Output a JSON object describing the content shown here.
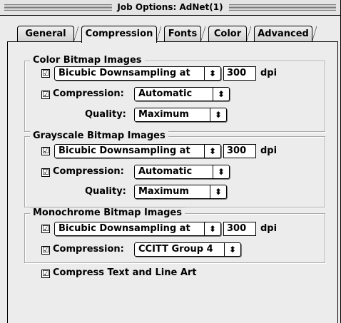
{
  "window": {
    "title": "Job Options: AdNet(1)"
  },
  "tabs": [
    "General",
    "Compression",
    "Fonts",
    "Color",
    "Advanced"
  ],
  "icons": {
    "checkbox_checked": "☑",
    "popup_arrows": "⬍"
  },
  "color_group": {
    "title": "Color Bitmap Images",
    "downsample_method": "Bicubic Downsampling at",
    "resolution": "300",
    "unit": "dpi",
    "compression_label": "Compression:",
    "compression_value": "Automatic",
    "quality_label": "Quality:",
    "quality_value": "Maximum"
  },
  "grayscale_group": {
    "title": "Grayscale Bitmap Images",
    "downsample_method": "Bicubic Downsampling at",
    "resolution": "300",
    "unit": "dpi",
    "compression_label": "Compression:",
    "compression_value": "Automatic",
    "quality_label": "Quality:",
    "quality_value": "Maximum"
  },
  "mono_group": {
    "title": "Monochrome Bitmap Images",
    "downsample_method": "Bicubic Downsampling at",
    "resolution": "300",
    "unit": "dpi",
    "compression_label": "Compression:",
    "compression_value": "CCITT Group 4"
  },
  "compress_text_label": "Compress Text and Line Art"
}
